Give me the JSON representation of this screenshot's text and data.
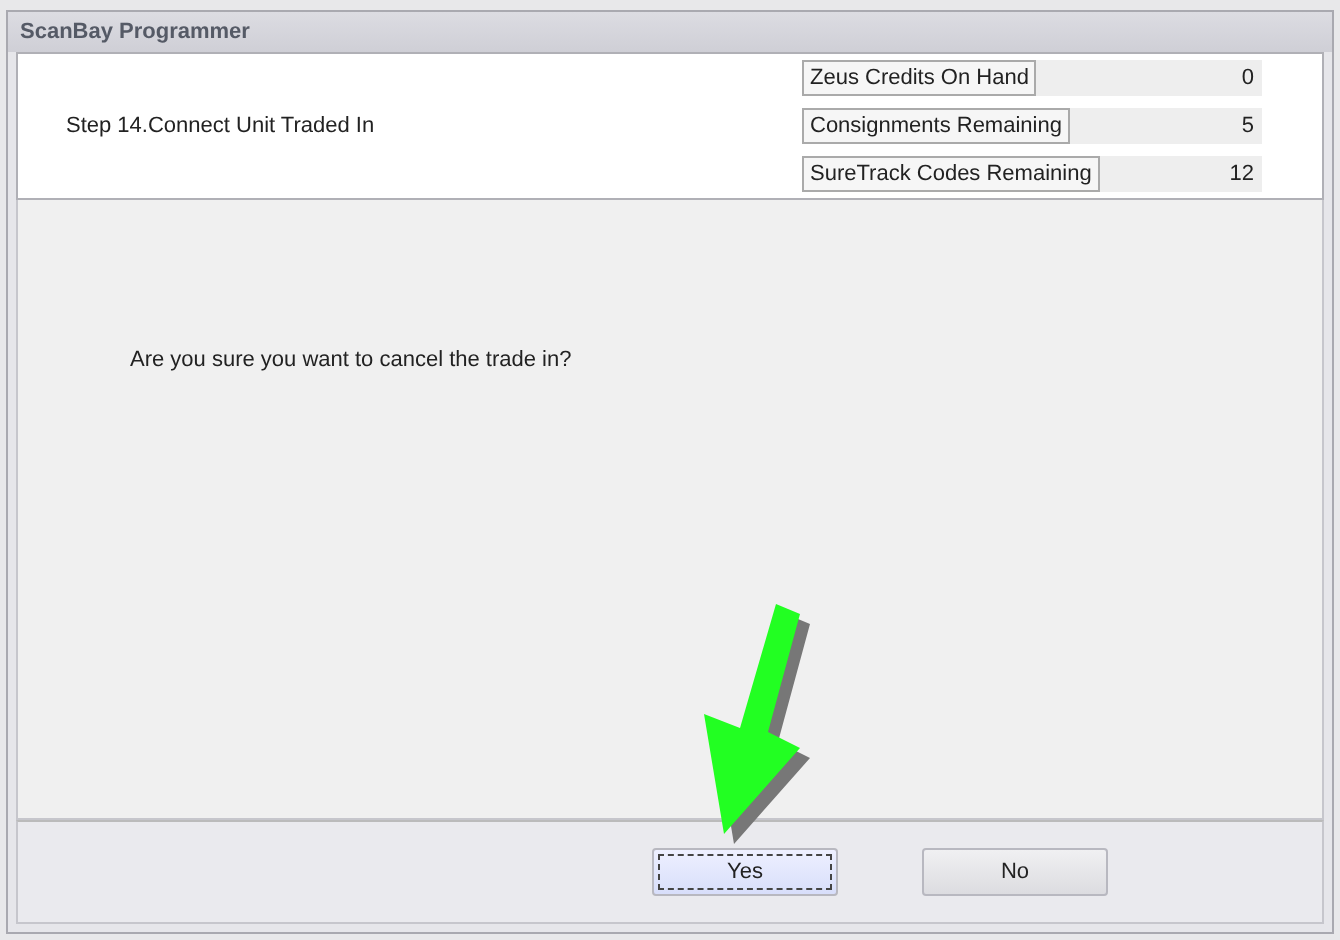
{
  "window": {
    "title": "ScanBay Programmer"
  },
  "step": "Step 14.Connect Unit Traded In",
  "counters": [
    {
      "label": "Zeus Credits On Hand",
      "value": "0"
    },
    {
      "label": "Consignments Remaining",
      "value": "5"
    },
    {
      "label": "SureTrack Codes Remaining",
      "value": "12"
    }
  ],
  "message": "Are you sure you want to cancel the trade in?",
  "buttons": [
    {
      "label": "Yes",
      "selected": true
    },
    {
      "label": "No",
      "selected": false
    }
  ]
}
